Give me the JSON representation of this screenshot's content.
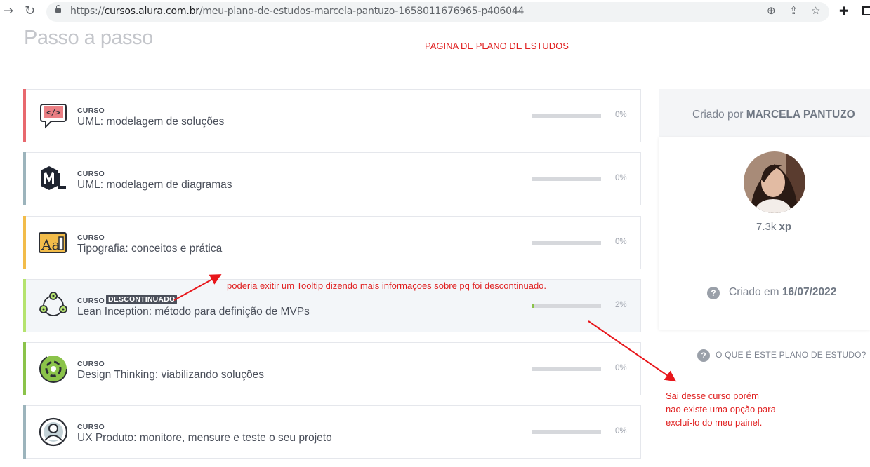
{
  "browser": {
    "url_prefix": "https://",
    "url_host": "cursos.alura.com.br",
    "url_path": "/meu-plano-de-estudos-marcela-pantuzo-1658011676965-p406044"
  },
  "page": {
    "title": "Passo a passo"
  },
  "annotations": {
    "top_note": "PAGINA DE PLANO DE ESTUDOS",
    "tooltip_note": "poderia exitir um Tooltip dizendo mais informaçoes sobre pq foi descontinuado.",
    "bottom_note_line1": "Sai desse curso porém",
    "bottom_note_line2": "nao existe uma opção para",
    "bottom_note_line3": "excluí-lo do meu painel."
  },
  "courses": [
    {
      "kind": "CURSO",
      "title": "UML: modelagem de soluções",
      "percent_label": "0%",
      "progress": 0,
      "stripe_color": "#e8686e",
      "icon": "uml-code-chat-icon"
    },
    {
      "kind": "CURSO",
      "title": "UML: modelagem de diagramas",
      "percent_label": "0%",
      "progress": 0,
      "stripe_color": "#9cb4bc",
      "icon": "uml-logo-icon"
    },
    {
      "kind": "CURSO",
      "title": "Tipografia: conceitos e prática",
      "percent_label": "0%",
      "progress": 0,
      "stripe_color": "#f2bc4a",
      "icon": "typography-icon"
    },
    {
      "kind": "CURSO",
      "badge": "DESCONTINUADO",
      "title": "Lean Inception: método para definição de MVPs",
      "percent_label": "2%",
      "progress": 2,
      "stripe_color": "#b5e36f",
      "icon": "lean-inception-icon"
    },
    {
      "kind": "CURSO",
      "title": "Design Thinking: viabilizando soluções",
      "percent_label": "0%",
      "progress": 0,
      "stripe_color": "#8bc34a",
      "icon": "design-thinking-icon"
    },
    {
      "kind": "CURSO",
      "title": "UX Produto: monitore, mensure e teste o seu projeto",
      "percent_label": "0%",
      "progress": 0,
      "stripe_color": "#9cb4bc",
      "icon": "ux-product-icon"
    }
  ],
  "sidebar": {
    "created_by_label": "Criado por",
    "author": "MARCELA PANTUZO",
    "xp_value": "7.3k",
    "xp_unit": "xp",
    "created_at_label": "Criado em",
    "created_at_date": "16/07/2022",
    "what_is_link": "O QUE É ESTE PLANO DE ESTUDO?"
  },
  "colors": {
    "accent_red": "#e02020",
    "progress_fill": "#8bc34a",
    "discontinued_card_bg": "#f3f6f9"
  }
}
